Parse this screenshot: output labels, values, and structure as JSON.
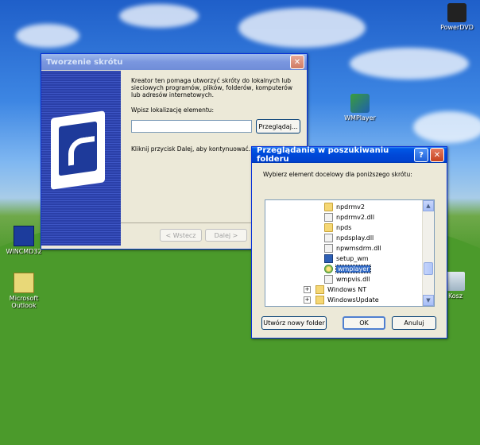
{
  "desktop": {
    "icons": [
      {
        "label": "PowerDVD"
      },
      {
        "label": "WMPlayer"
      },
      {
        "label": "WINCMD32"
      },
      {
        "label": "Microsoft Outlook"
      },
      {
        "label": "Kosz"
      }
    ]
  },
  "shortcut_wizard": {
    "title": "Tworzenie skrótu",
    "description": "Kreator ten pomaga utworzyć skróty do lokalnych lub sieciowych programów, plików, folderów, komputerów lub adresów internetowych.",
    "location_label": "Wpisz lokalizację elementu:",
    "location_value": "",
    "browse_button": "Przeglądaj...",
    "instruction": "Kliknij przycisk Dalej, aby kontynuować.",
    "back_button": "< Wstecz",
    "next_button": "Dalej >"
  },
  "browse_dialog": {
    "title": "Przeglądanie w poszukiwaniu folderu",
    "prompt": "Wybierz element docelowy dla poniższego skrótu:",
    "items": [
      {
        "label": "npdrmv2",
        "icon": "folder"
      },
      {
        "label": "npdrmv2.dll",
        "icon": "dll"
      },
      {
        "label": "npds",
        "icon": "folder"
      },
      {
        "label": "npdsplay.dll",
        "icon": "dll"
      },
      {
        "label": "npwmsdrm.dll",
        "icon": "dll"
      },
      {
        "label": "setup_wm",
        "icon": "exe"
      },
      {
        "label": "wmplayer",
        "icon": "player"
      },
      {
        "label": "wmpvis.dll",
        "icon": "dll"
      },
      {
        "label": "Windows NT",
        "icon": "dir",
        "expander": "+"
      },
      {
        "label": "WindowsUpdate",
        "icon": "dir",
        "expander": "+"
      }
    ],
    "selected_item": "wmplayer",
    "new_folder_button": "Utwórz nowy folder",
    "ok_button": "OK",
    "cancel_button": "Anuluj"
  }
}
